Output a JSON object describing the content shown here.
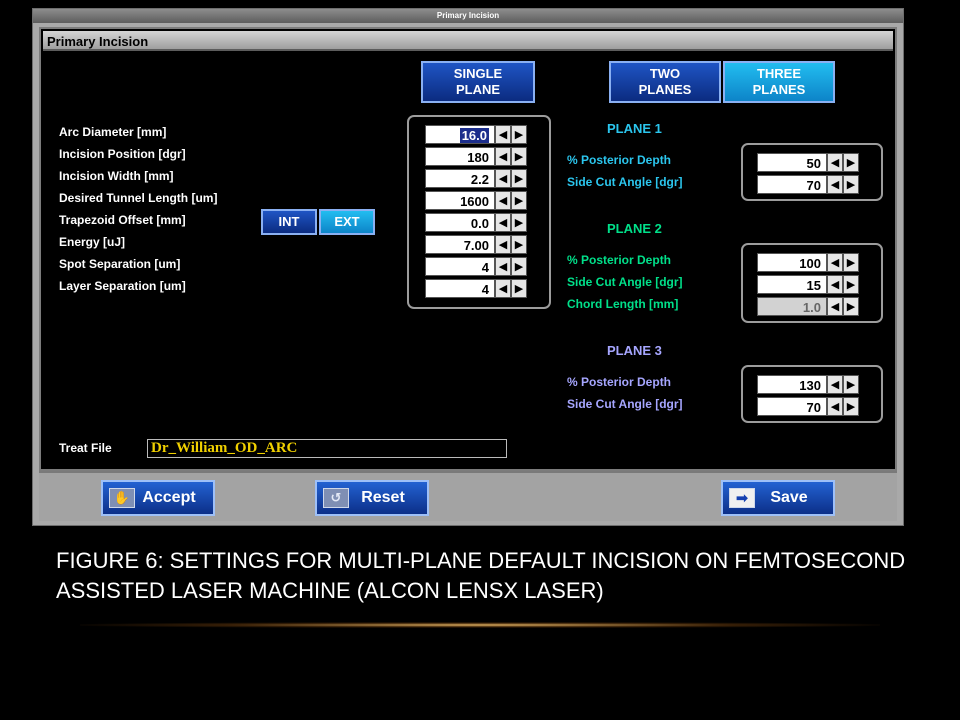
{
  "window": {
    "title": "Primary Incision"
  },
  "panel": {
    "title": "Primary Incision"
  },
  "plane_mode": {
    "single": "SINGLE\nPLANE",
    "two": "TWO\nPLANES",
    "three": "THREE\nPLANES"
  },
  "params": [
    {
      "label": "Arc Diameter [mm]",
      "value": "16.0"
    },
    {
      "label": "Incision Position [dgr]",
      "value": "180"
    },
    {
      "label": "Incision Width [mm]",
      "value": "2.2"
    },
    {
      "label": "Desired Tunnel Length [um]",
      "value": "1600"
    },
    {
      "label": "Trapezoid Offset [mm]",
      "value": "0.0"
    },
    {
      "label": "Energy [uJ]",
      "value": "7.00"
    },
    {
      "label": "Spot Separation [um]",
      "value": "4"
    },
    {
      "label": "Layer Separation [um]",
      "value": "4"
    }
  ],
  "offset_toggle": {
    "int": "INT",
    "ext": "EXT"
  },
  "plane1": {
    "title": "PLANE 1",
    "fields": [
      {
        "label": "% Posterior Depth",
        "value": "50"
      },
      {
        "label": "Side Cut Angle [dgr]",
        "value": "70"
      }
    ]
  },
  "plane2": {
    "title": "PLANE 2",
    "fields": [
      {
        "label": "% Posterior Depth",
        "value": "100"
      },
      {
        "label": "Side Cut Angle [dgr]",
        "value": "15"
      },
      {
        "label": "Chord Length [mm]",
        "value": "1.0"
      }
    ]
  },
  "plane3": {
    "title": "PLANE 3",
    "fields": [
      {
        "label": "% Posterior Depth",
        "value": "130"
      },
      {
        "label": "Side Cut Angle [dgr]",
        "value": "70"
      }
    ]
  },
  "treat_file": {
    "label": "Treat File",
    "value": "Dr_William_OD_ARC"
  },
  "actions": {
    "accept": "Accept",
    "reset": "Reset",
    "save": "Save"
  },
  "arrows": {
    "left": "◀",
    "right": "▶"
  },
  "icons": {
    "accept": "accept-icon",
    "reset": "reset-icon",
    "save": "arrow-right-icon"
  },
  "caption": "Figure 6: Settings for multi-plane default incision on femtosecond assisted laser machine (Alcon LenSx Laser)"
}
